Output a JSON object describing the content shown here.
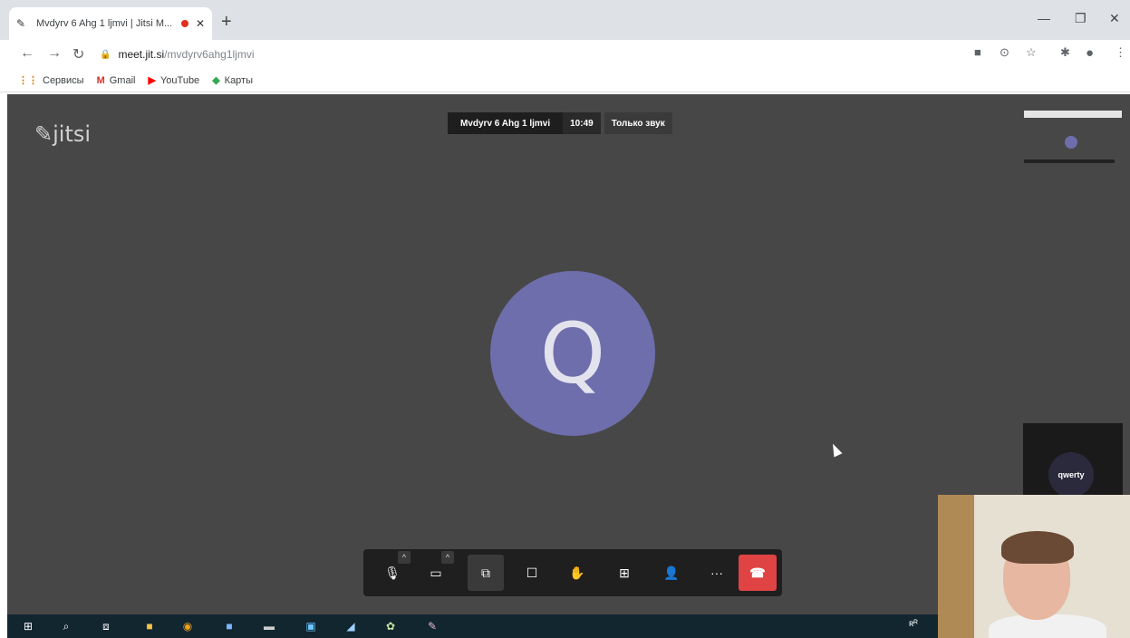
{
  "browser": {
    "tab_title": "Mvdyrv 6 Ahg 1 ljmvi | Jitsi M...",
    "url_host": "meet.jit.si",
    "url_path": "/mvdyrv6ahg1ljmvi"
  },
  "bookmarks": [
    {
      "label": "Сервисы",
      "icon": "apps-icon"
    },
    {
      "label": "Gmail",
      "icon": "gmail-icon"
    },
    {
      "label": "YouTube",
      "icon": "youtube-icon"
    },
    {
      "label": "Карты",
      "icon": "maps-icon"
    }
  ],
  "meeting": {
    "logo": "jitsi",
    "subject": "Mvdyrv 6 Ahg 1 ljmvi",
    "timer": "10:49",
    "audio_only": "Только звук",
    "avatar_initial": "Q",
    "local_name": "qwerty"
  },
  "colors": {
    "meeting_bg": "#474747",
    "avatar": "#6e6eac",
    "hangup": "#e04343"
  },
  "toolbar_icons": [
    "microphone-icon",
    "camera-icon",
    "share-screen-icon",
    "chat-icon",
    "raise-hand-icon",
    "tile-view-icon",
    "invite-icon",
    "more-icon",
    "hangup-icon"
  ]
}
